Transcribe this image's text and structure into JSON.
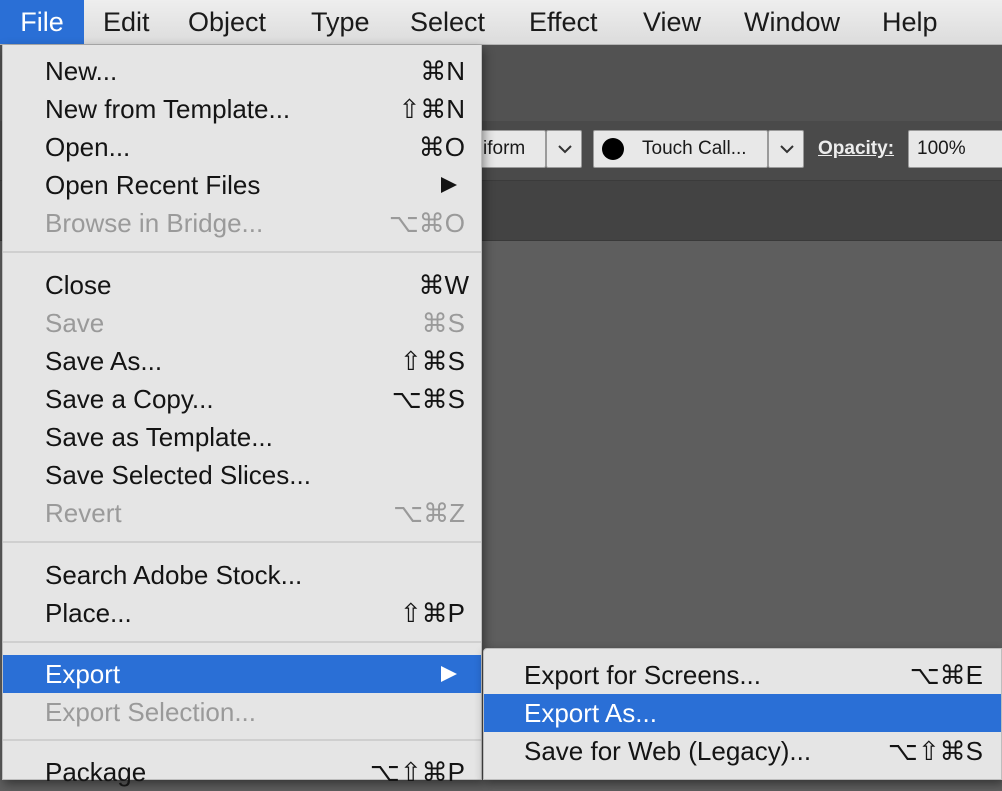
{
  "menubar": {
    "items": [
      "File",
      "Edit",
      "Object",
      "Type",
      "Select",
      "Effect",
      "View",
      "Window",
      "Help"
    ],
    "active": "File"
  },
  "control_bar": {
    "stroke_profile_text": "iform",
    "brush_text": "Touch Call...",
    "opacity_label": "Opacity:",
    "opacity_value": "100%"
  },
  "file_menu": {
    "items": [
      {
        "label": "New...",
        "shortcut": "⌘N",
        "disabled": false
      },
      {
        "label": "New from Template...",
        "shortcut": "⇧⌘N",
        "disabled": false
      },
      {
        "label": "Open...",
        "shortcut": "⌘O",
        "disabled": false
      },
      {
        "label": "Open Recent Files",
        "shortcut": "",
        "submenu": true,
        "disabled": false
      },
      {
        "label": "Browse in Bridge...",
        "shortcut": "⌥⌘O",
        "disabled": true
      },
      {
        "label": "Close",
        "shortcut": "⌘W",
        "disabled": false
      },
      {
        "label": "Save",
        "shortcut": "⌘S",
        "disabled": true
      },
      {
        "label": "Save As...",
        "shortcut": "⇧⌘S",
        "disabled": false
      },
      {
        "label": "Save a Copy...",
        "shortcut": "⌥⌘S",
        "disabled": false
      },
      {
        "label": "Save as Template...",
        "shortcut": "",
        "disabled": false
      },
      {
        "label": "Save Selected Slices...",
        "shortcut": "",
        "disabled": false
      },
      {
        "label": "Revert",
        "shortcut": "⌥⌘Z",
        "disabled": true
      },
      {
        "label": "Search Adobe Stock...",
        "shortcut": "",
        "disabled": false
      },
      {
        "label": "Place...",
        "shortcut": "⇧⌘P",
        "disabled": false
      },
      {
        "label": "Export",
        "shortcut": "",
        "submenu": true,
        "highlighted": true
      },
      {
        "label": "Export Selection...",
        "shortcut": "",
        "disabled": true
      },
      {
        "label": "Package",
        "shortcut": "⌥⇧⌘P",
        "disabled": false
      }
    ]
  },
  "export_submenu": {
    "items": [
      {
        "label": "Export for Screens...",
        "shortcut": "⌥⌘E"
      },
      {
        "label": "Export As...",
        "shortcut": "",
        "highlighted": true
      },
      {
        "label": "Save for Web (Legacy)...",
        "shortcut": "⌥⇧⌘S"
      }
    ]
  },
  "colors": {
    "highlight": "#2a6fd6",
    "menu_bg": "#e5e5e5",
    "disabled_text": "#9a9a9a",
    "app_bg": "#5e5e5e"
  }
}
